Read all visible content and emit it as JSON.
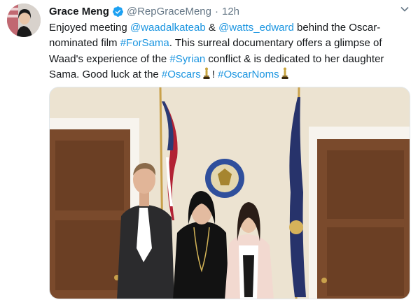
{
  "tweet": {
    "author_name": "Grace Meng",
    "handle": "@RepGraceMeng",
    "separator": "·",
    "time": "12h",
    "text_parts": [
      {
        "t": "Enjoyed meeting ",
        "link": false
      },
      {
        "t": "@waadalkateab",
        "link": true
      },
      {
        "t": " & ",
        "link": false
      },
      {
        "t": "@watts_edward",
        "link": true
      },
      {
        "t": " behind the Oscar-nominated film ",
        "link": false
      },
      {
        "t": "#ForSama",
        "link": true
      },
      {
        "t": ". This surreal documentary offers a glimpse of Waad's experience of the ",
        "link": false
      },
      {
        "t": "#Syrian",
        "link": true
      },
      {
        "t": " conflict & is dedicated to her daughter Sama. Good luck at the ",
        "link": false
      },
      {
        "t": "#Oscars",
        "link": true
      },
      {
        "t": "[oscar]",
        "link": false
      },
      {
        "t": "! ",
        "link": false
      },
      {
        "t": "#OscarNoms",
        "link": true
      },
      {
        "t": "[oscar]",
        "link": false
      }
    ]
  },
  "icons": {
    "verified": "verified-badge-icon",
    "caret": "chevron-down-icon",
    "oscar": "oscar-trophy-icon"
  },
  "colors": {
    "link": "#1b95e0",
    "verified": "#1da1f2",
    "meta": "#657786",
    "oscar_gold": "#c8a43c"
  }
}
